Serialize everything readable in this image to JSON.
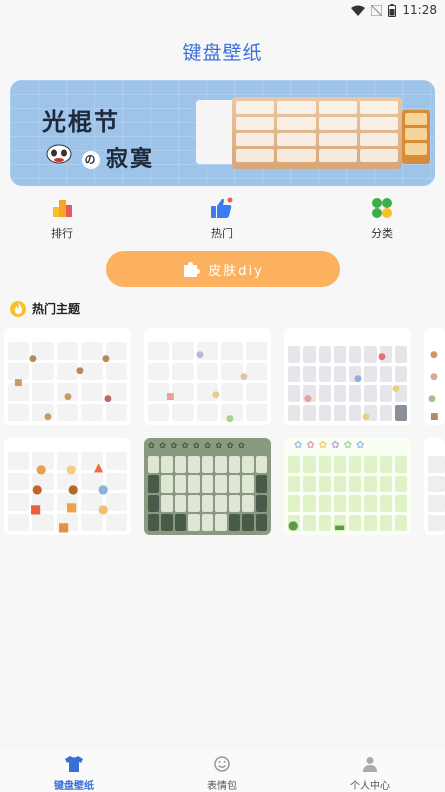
{
  "status": {
    "time": "11:28"
  },
  "header": {
    "title": "键盘壁纸"
  },
  "categories": [
    {
      "label": "排行",
      "icon": "ranking-icon"
    },
    {
      "label": "热门",
      "icon": "thumbs-up-icon"
    },
    {
      "label": "分类",
      "icon": "clover-icon"
    }
  ],
  "diy_button": {
    "label": "皮肤diy"
  },
  "section": {
    "title": "热门主题"
  },
  "bottom_nav": [
    {
      "label": "键盘壁纸",
      "icon": "tshirt-icon",
      "active": true
    },
    {
      "label": "表情包",
      "icon": "smiley-icon",
      "active": false
    },
    {
      "label": "个人中心",
      "icon": "person-icon",
      "active": false
    }
  ],
  "colors": {
    "accent": "#3a6fd8",
    "diy_button": "#fbb15f"
  }
}
